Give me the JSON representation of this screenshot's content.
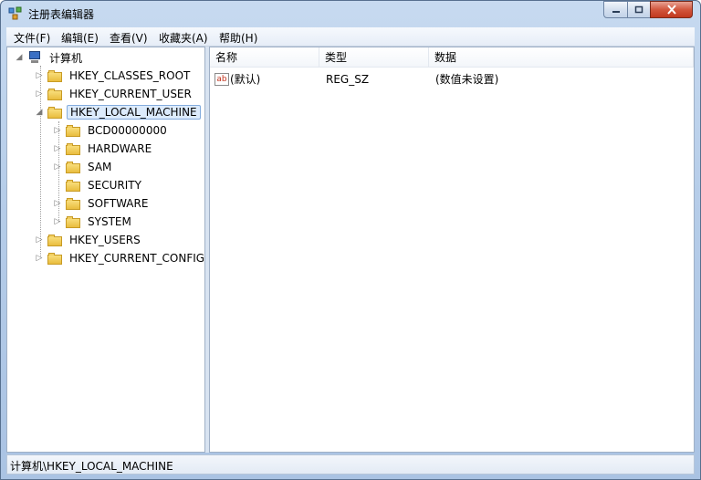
{
  "window": {
    "title": "注册表编辑器"
  },
  "menu": [
    "文件(F)",
    "编辑(E)",
    "查看(V)",
    "收藏夹(A)",
    "帮助(H)"
  ],
  "tree": {
    "root": "计算机",
    "hives": [
      {
        "label": "HKEY_CLASSES_ROOT"
      },
      {
        "label": "HKEY_CURRENT_USER"
      },
      {
        "label": "HKEY_LOCAL_MACHINE",
        "expanded": true,
        "selected": true,
        "children": [
          "BCD00000000",
          "HARDWARE",
          "SAM",
          "SECURITY",
          "SOFTWARE",
          "SYSTEM"
        ]
      },
      {
        "label": "HKEY_USERS"
      },
      {
        "label": "HKEY_CURRENT_CONFIG"
      }
    ]
  },
  "values": {
    "columns": [
      "名称",
      "类型",
      "数据"
    ],
    "rows": [
      {
        "name": "(默认)",
        "type": "REG_SZ",
        "data": "(数值未设置)",
        "icon": "ab-string-icon"
      }
    ]
  },
  "status": {
    "path": "计算机\\HKEY_LOCAL_MACHINE"
  }
}
